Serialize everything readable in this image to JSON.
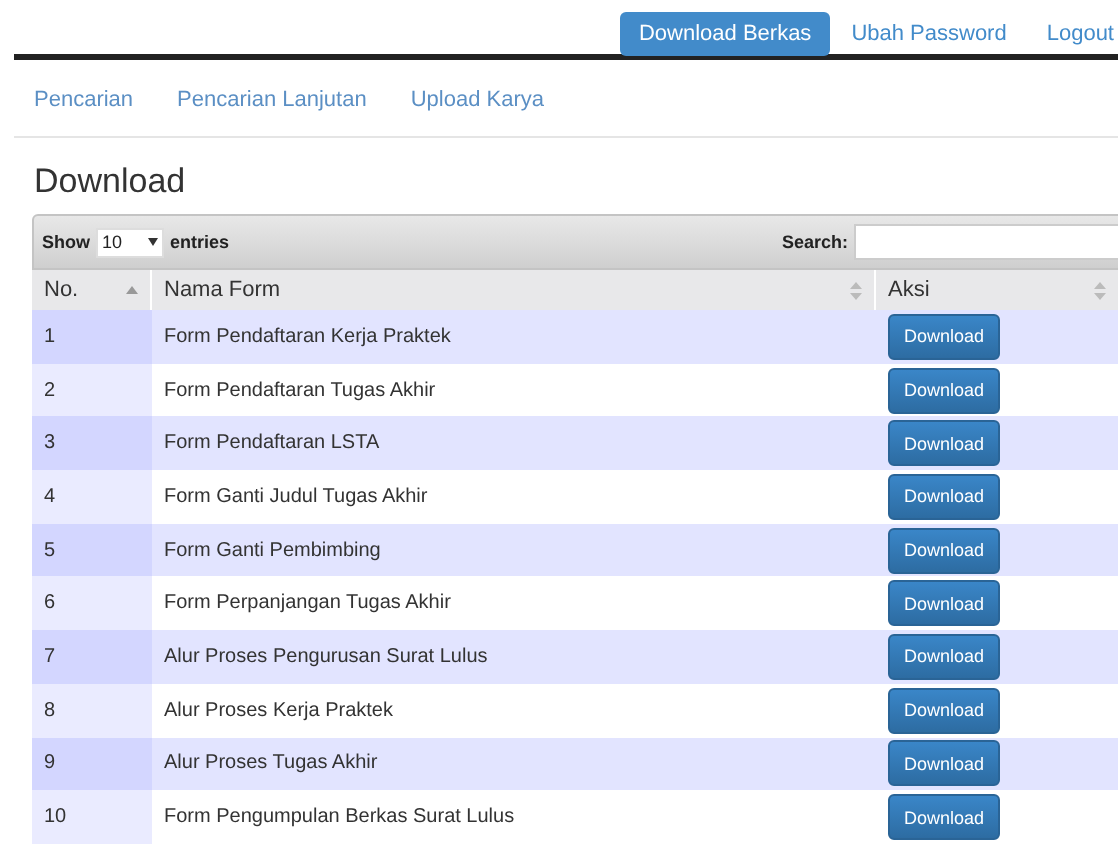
{
  "top_nav": [
    {
      "label": "Download Berkas",
      "selected": true
    },
    {
      "label": "Ubah Password",
      "selected": false
    },
    {
      "label": "Logout",
      "selected": false
    }
  ],
  "sub_nav": [
    "Pencarian",
    "Pencarian Lanjutan",
    "Upload Karya"
  ],
  "heading": "Download",
  "table_controls": {
    "show_label": "Show",
    "page_size": "10",
    "entries_label": "entries",
    "search_label": "Search:"
  },
  "table": {
    "columns": [
      {
        "label": "No.",
        "kind": "ascending"
      },
      {
        "label": "Nama Form",
        "kind": "sortable"
      },
      {
        "label": "Aksi",
        "kind": "sortable"
      }
    ],
    "rows": [
      {
        "no": "1",
        "name": "Form Pendaftaran Kerja Praktek",
        "action": "Download"
      },
      {
        "no": "2",
        "name": "Form Pendaftaran Tugas Akhir",
        "action": "Download"
      },
      {
        "no": "3",
        "name": "Form Pendaftaran LSTA",
        "action": "Download"
      },
      {
        "no": "4",
        "name": "Form Ganti Judul Tugas Akhir",
        "action": "Download"
      },
      {
        "no": "5",
        "name": "Form Ganti Pembimbing",
        "action": "Download"
      },
      {
        "no": "6",
        "name": "Form Perpanjangan Tugas Akhir",
        "action": "Download"
      },
      {
        "no": "7",
        "name": "Alur Proses Pengurusan Surat Lulus",
        "action": "Download"
      },
      {
        "no": "8",
        "name": "Alur Proses Kerja Praktek",
        "action": "Download"
      },
      {
        "no": "9",
        "name": "Alur Proses Tugas Akhir",
        "action": "Download"
      },
      {
        "no": "10",
        "name": "Form Pengumpulan Berkas Surat Lulus",
        "action": "Download"
      }
    ]
  }
}
